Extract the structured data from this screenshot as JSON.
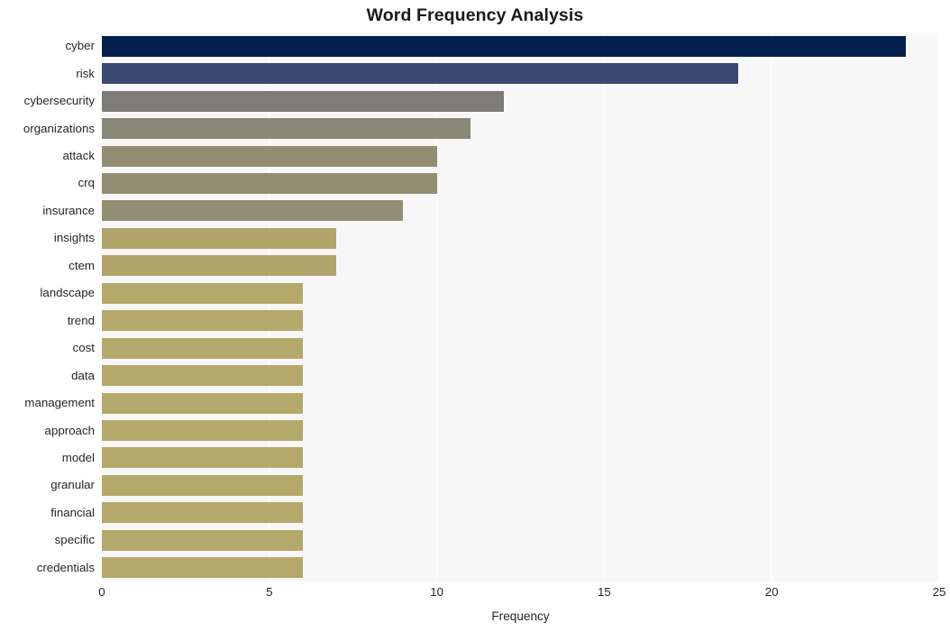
{
  "chart_data": {
    "type": "bar",
    "orientation": "horizontal",
    "title": "Word Frequency Analysis",
    "xlabel": "Frequency",
    "ylabel": "",
    "categories": [
      "cyber",
      "risk",
      "cybersecurity",
      "organizations",
      "attack",
      "crq",
      "insurance",
      "insights",
      "ctem",
      "landscape",
      "trend",
      "cost",
      "data",
      "management",
      "approach",
      "model",
      "granular",
      "financial",
      "specific",
      "credentials"
    ],
    "values": [
      24,
      19,
      12,
      11,
      10,
      10,
      9,
      7,
      7,
      6,
      6,
      6,
      6,
      6,
      6,
      6,
      6,
      6,
      6,
      6
    ],
    "bar_colors": [
      "#03204c",
      "#3b4a70",
      "#7d7c78",
      "#898776",
      "#938d74",
      "#938d74",
      "#948e74",
      "#b1a56c",
      "#b1a56c",
      "#b4a86b",
      "#b4a86b",
      "#b4a86b",
      "#b4a86b",
      "#b4a86b",
      "#b4a86b",
      "#b4a86b",
      "#b4a86b",
      "#b4a86b",
      "#b4a86b",
      "#b4a86b"
    ],
    "xlim": [
      0,
      25
    ],
    "xticks": [
      0,
      5,
      10,
      15,
      20,
      25
    ],
    "xtick_labels": [
      "0",
      "5",
      "10",
      "15",
      "20",
      "25"
    ],
    "grid": true,
    "grid_axis": "x",
    "gridline_color": "#ffffff",
    "legend": null,
    "plot_background": "#f7f7f7",
    "figure_background": "#ffffff"
  }
}
